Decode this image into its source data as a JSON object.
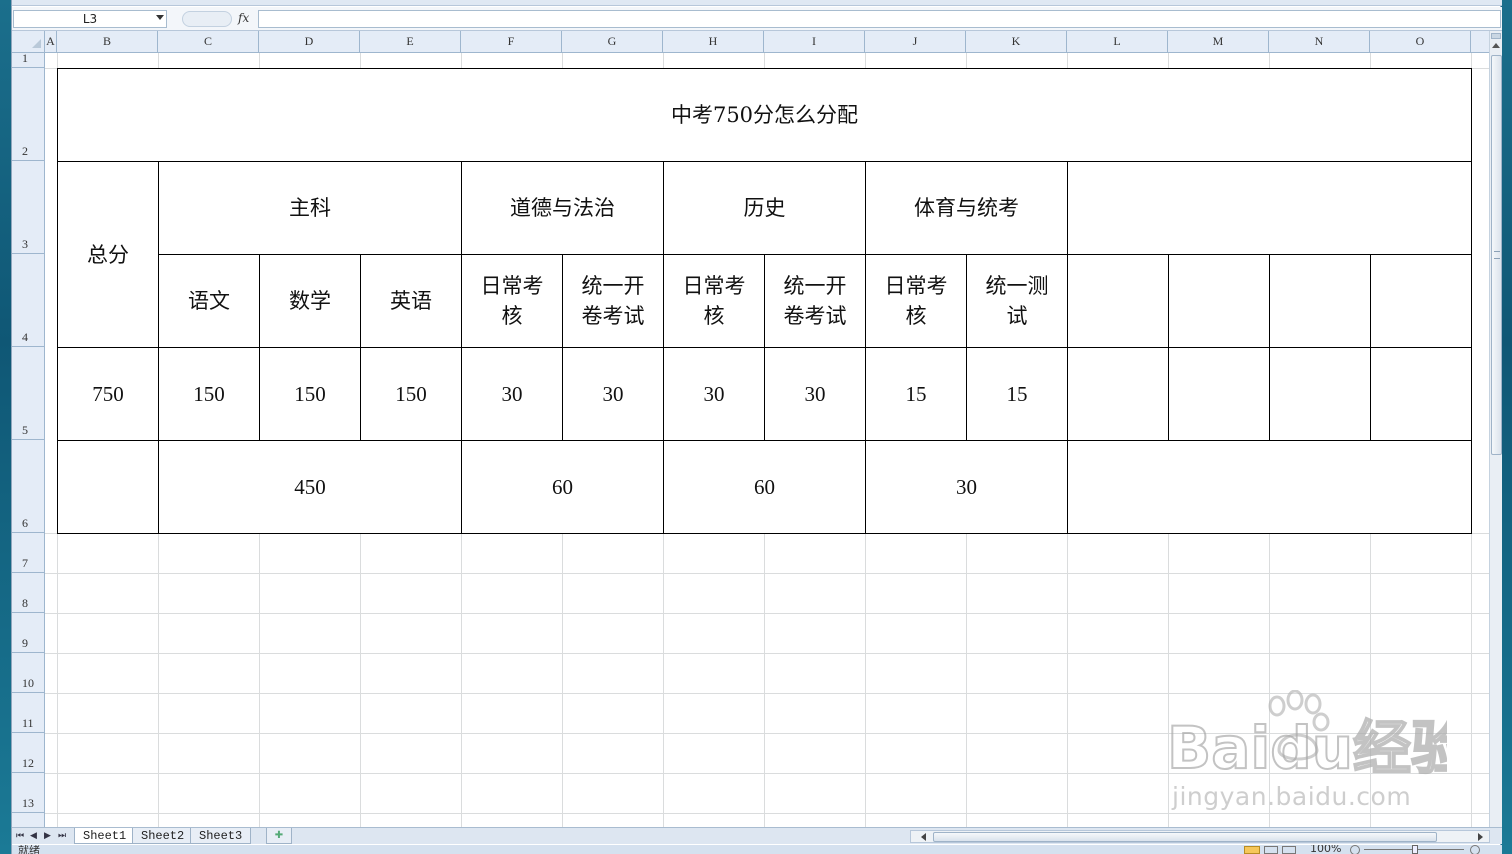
{
  "formula_bar": {
    "name_box": "L3",
    "fx_label": "fx",
    "formula": ""
  },
  "columns": [
    "A",
    "B",
    "C",
    "D",
    "E",
    "F",
    "G",
    "H",
    "I",
    "J",
    "K",
    "L",
    "M",
    "N",
    "O"
  ],
  "rows": [
    "1",
    "2",
    "3",
    "4",
    "5",
    "6",
    "7",
    "8",
    "9",
    "10",
    "11",
    "12",
    "13"
  ],
  "table": {
    "title": "中考750分怎么分配",
    "total_header": "总分",
    "groups": {
      "main": "主科",
      "morality": "道德与法治",
      "history": "历史",
      "pe": "体育与统考",
      "extra": ""
    },
    "subjects": {
      "chinese": "语文",
      "math": "数学",
      "english": "英语",
      "morality_daily": "日常考核",
      "morality_exam": "统一开卷考试",
      "history_daily": "日常考核",
      "history_exam": "统一开卷考试",
      "pe_daily": "日常考核",
      "pe_exam": "统一测试"
    },
    "scores": {
      "total": "750",
      "chinese": "150",
      "math": "150",
      "english": "150",
      "morality_daily": "30",
      "morality_exam": "30",
      "history_daily": "30",
      "history_exam": "30",
      "pe_daily": "15",
      "pe_exam": "15"
    },
    "group_totals": {
      "main": "450",
      "morality": "60",
      "history": "60",
      "pe": "30"
    }
  },
  "sheets": [
    "Sheet1",
    "Sheet2",
    "Sheet3"
  ],
  "active_sheet": "Sheet1",
  "status": {
    "ready": "就绪",
    "zoom": "100%"
  },
  "watermark": {
    "brand": "Baidu经验",
    "url": "jingyan.baidu.com"
  },
  "colors": {
    "header_bg": "#e4ecf7",
    "gridline": "#dadcdd",
    "border": "#000000"
  }
}
